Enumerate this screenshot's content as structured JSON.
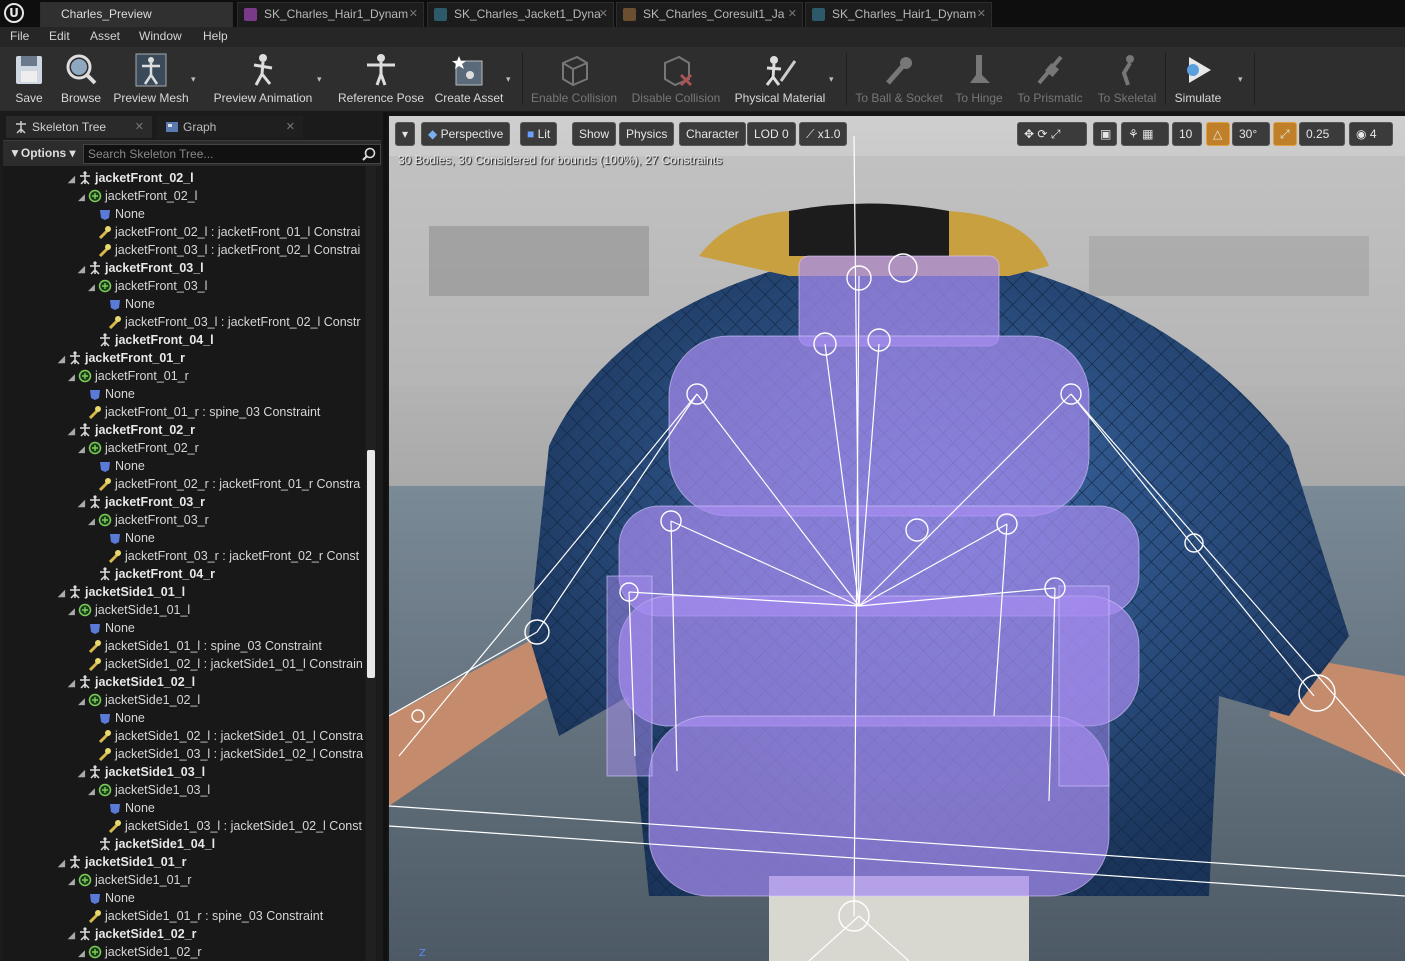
{
  "app": {
    "logo": "U"
  },
  "tabs": [
    {
      "label": "Charles_Preview",
      "active": true
    },
    {
      "label": "SK_Charles_Hair1_Dynam",
      "active": false
    },
    {
      "label": "SK_Charles_Jacket1_Dyna",
      "active": false
    },
    {
      "label": "SK_Charles_Coresuit1_Ja",
      "active": false
    },
    {
      "label": "SK_Charles_Hair1_Dynam",
      "active": false
    }
  ],
  "menu": [
    "File",
    "Edit",
    "Asset",
    "Window",
    "Help"
  ],
  "toolbar": {
    "buttons": [
      {
        "label": "Save",
        "icon": "save-icon",
        "disabled": false
      },
      {
        "label": "Browse",
        "icon": "browse-icon",
        "disabled": false
      },
      {
        "label": "Preview Mesh",
        "icon": "preview-mesh-icon",
        "disabled": false
      },
      {
        "label": "Preview Animation",
        "icon": "preview-animation-icon",
        "disabled": false
      },
      {
        "label": "Reference Pose",
        "icon": "reference-pose-icon",
        "disabled": false
      },
      {
        "label": "Create Asset",
        "icon": "create-asset-icon",
        "disabled": false
      },
      {
        "label": "Enable Collision",
        "icon": "enable-collision-icon",
        "disabled": true
      },
      {
        "label": "Disable Collision",
        "icon": "disable-collision-icon",
        "disabled": true
      },
      {
        "label": "Physical Material",
        "icon": "physical-material-icon",
        "disabled": false
      },
      {
        "label": "To Ball & Socket",
        "icon": "ball-socket-icon",
        "disabled": true
      },
      {
        "label": "To Hinge",
        "icon": "hinge-icon",
        "disabled": true
      },
      {
        "label": "To Prismatic",
        "icon": "prismatic-icon",
        "disabled": true
      },
      {
        "label": "To Skeletal",
        "icon": "skeletal-icon",
        "disabled": true
      },
      {
        "label": "Simulate",
        "icon": "simulate-icon",
        "disabled": false
      }
    ]
  },
  "panel_tabs": [
    {
      "label": "Skeleton Tree",
      "icon": "skeleton-tree-icon"
    },
    {
      "label": "Graph",
      "icon": "graph-icon"
    }
  ],
  "tree_header": {
    "options_label": "Options",
    "search_placeholder": "Search Skeleton Tree..."
  },
  "tree": [
    {
      "type": "bone",
      "depth": 2,
      "label": "jacketFront_02_l"
    },
    {
      "type": "body",
      "depth": 3,
      "label": "jacketFront_02_l"
    },
    {
      "type": "shape",
      "depth": 4,
      "label": "None"
    },
    {
      "type": "constraint",
      "depth": 4,
      "label": "jacketFront_02_l : jacketFront_01_l Constrai"
    },
    {
      "type": "constraint",
      "depth": 4,
      "label": "jacketFront_03_l : jacketFront_02_l Constrai"
    },
    {
      "type": "bone",
      "depth": 3,
      "label": "jacketFront_03_l"
    },
    {
      "type": "body",
      "depth": 4,
      "label": "jacketFront_03_l"
    },
    {
      "type": "shape",
      "depth": 5,
      "label": "None"
    },
    {
      "type": "constraint",
      "depth": 5,
      "label": "jacketFront_03_l : jacketFront_02_l Constr"
    },
    {
      "type": "bone-leaf",
      "depth": 4,
      "label": "jacketFront_04_l"
    },
    {
      "type": "bone",
      "depth": 1,
      "label": "jacketFront_01_r"
    },
    {
      "type": "body",
      "depth": 2,
      "label": "jacketFront_01_r"
    },
    {
      "type": "shape",
      "depth": 3,
      "label": "None"
    },
    {
      "type": "constraint",
      "depth": 3,
      "label": "jacketFront_01_r : spine_03 Constraint"
    },
    {
      "type": "bone",
      "depth": 2,
      "label": "jacketFront_02_r"
    },
    {
      "type": "body",
      "depth": 3,
      "label": "jacketFront_02_r"
    },
    {
      "type": "shape",
      "depth": 4,
      "label": "None"
    },
    {
      "type": "constraint",
      "depth": 4,
      "label": "jacketFront_02_r : jacketFront_01_r Constra"
    },
    {
      "type": "bone",
      "depth": 3,
      "label": "jacketFront_03_r"
    },
    {
      "type": "body",
      "depth": 4,
      "label": "jacketFront_03_r"
    },
    {
      "type": "shape",
      "depth": 5,
      "label": "None"
    },
    {
      "type": "constraint",
      "depth": 5,
      "label": "jacketFront_03_r : jacketFront_02_r Const"
    },
    {
      "type": "bone-leaf",
      "depth": 4,
      "label": "jacketFront_04_r"
    },
    {
      "type": "bone",
      "depth": 1,
      "label": "jacketSide1_01_l"
    },
    {
      "type": "body",
      "depth": 2,
      "label": "jacketSide1_01_l"
    },
    {
      "type": "shape",
      "depth": 3,
      "label": "None"
    },
    {
      "type": "constraint",
      "depth": 3,
      "label": "jacketSide1_01_l : spine_03 Constraint"
    },
    {
      "type": "constraint",
      "depth": 3,
      "label": "jacketSide1_02_l : jacketSide1_01_l Constrain"
    },
    {
      "type": "bone",
      "depth": 2,
      "label": "jacketSide1_02_l"
    },
    {
      "type": "body",
      "depth": 3,
      "label": "jacketSide1_02_l"
    },
    {
      "type": "shape",
      "depth": 4,
      "label": "None"
    },
    {
      "type": "constraint",
      "depth": 4,
      "label": "jacketSide1_02_l : jacketSide1_01_l Constra"
    },
    {
      "type": "constraint",
      "depth": 4,
      "label": "jacketSide1_03_l : jacketSide1_02_l Constra"
    },
    {
      "type": "bone",
      "depth": 3,
      "label": "jacketSide1_03_l"
    },
    {
      "type": "body",
      "depth": 4,
      "label": "jacketSide1_03_l"
    },
    {
      "type": "shape",
      "depth": 5,
      "label": "None"
    },
    {
      "type": "constraint",
      "depth": 5,
      "label": "jacketSide1_03_l : jacketSide1_02_l Const"
    },
    {
      "type": "bone-leaf",
      "depth": 4,
      "label": "jacketSide1_04_l"
    },
    {
      "type": "bone",
      "depth": 1,
      "label": "jacketSide1_01_r"
    },
    {
      "type": "body",
      "depth": 2,
      "label": "jacketSide1_01_r"
    },
    {
      "type": "shape",
      "depth": 3,
      "label": "None"
    },
    {
      "type": "constraint",
      "depth": 3,
      "label": "jacketSide1_01_r : spine_03 Constraint"
    },
    {
      "type": "bone",
      "depth": 2,
      "label": "jacketSide1_02_r"
    },
    {
      "type": "body",
      "depth": 3,
      "label": "jacketSide1_02_r"
    }
  ],
  "viewport": {
    "left_buttons": [
      {
        "label": "▾",
        "name": "viewport-options-button"
      },
      {
        "label": "Perspective",
        "name": "perspective-button"
      },
      {
        "label": "Lit",
        "name": "lit-button"
      },
      {
        "label": "Show",
        "name": "show-button"
      },
      {
        "label": "Physics",
        "name": "physics-button"
      },
      {
        "label": "Character",
        "name": "character-button"
      },
      {
        "label": "LOD 0",
        "name": "lod-button"
      },
      {
        "label": "x1.0",
        "name": "playback-speed-button"
      }
    ],
    "grid_snap": "10",
    "rotation_snap": "30°",
    "scale_snap": "0.25",
    "camera_speed": "4",
    "stats": "30 Bodies, 30 Considered for bounds (100%), 27 Constraints",
    "axis_label": "Z"
  }
}
